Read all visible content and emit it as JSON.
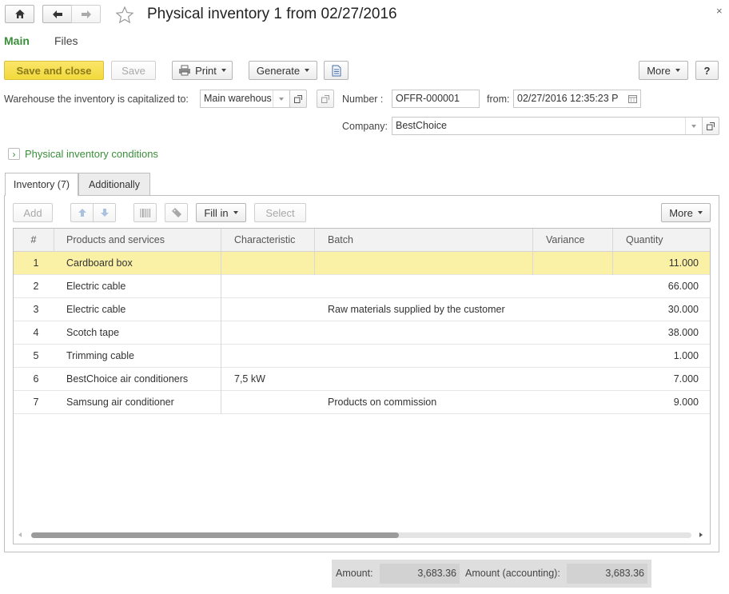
{
  "window": {
    "title": "Physical inventory 1 from 02/27/2016",
    "close_glyph": "×"
  },
  "nav": {
    "home_icon": "home-icon",
    "back_icon": "arrow-left-icon",
    "forward_icon": "arrow-right-icon",
    "favorite_icon": "star-icon"
  },
  "sections": {
    "main": "Main",
    "files": "Files"
  },
  "toolbar": {
    "save_and_close": "Save and close",
    "save": "Save",
    "print": "Print",
    "generate": "Generate",
    "more": "More",
    "help": "?"
  },
  "header": {
    "warehouse_label": "Warehouse the inventory is capitalized to:",
    "warehouse_value": "Main warehous",
    "number_label": "Number :",
    "number_value": "OFFR-000001",
    "from_label": "from:",
    "from_value": "02/27/2016 12:35:23 P",
    "company_label": "Company:",
    "company_value": "BestChoice"
  },
  "conditions": {
    "label": "Physical inventory conditions",
    "expander_glyph": "›"
  },
  "tabs": [
    {
      "label": "Inventory (7)"
    },
    {
      "label": "Additionally"
    }
  ],
  "grid_toolbar": {
    "add": "Add",
    "fill_in": "Fill in",
    "select": "Select",
    "more": "More"
  },
  "table": {
    "columns": [
      "#",
      "Products and services",
      "Characteristic",
      "Batch",
      "Variance",
      "Quantity"
    ],
    "rows": [
      {
        "num": "1",
        "product": "Cardboard box",
        "characteristic": "",
        "batch": "",
        "variance": "",
        "quantity": "11.000"
      },
      {
        "num": "2",
        "product": "Electric cable",
        "characteristic": "",
        "batch": "",
        "variance": "",
        "quantity": "66.000"
      },
      {
        "num": "3",
        "product": "Electric cable",
        "characteristic": "",
        "batch": "Raw materials supplied by the customer",
        "variance": "",
        "quantity": "30.000"
      },
      {
        "num": "4",
        "product": "Scotch tape",
        "characteristic": "",
        "batch": "",
        "variance": "",
        "quantity": "38.000"
      },
      {
        "num": "5",
        "product": "Trimming cable",
        "characteristic": "",
        "batch": "",
        "variance": "",
        "quantity": "1.000"
      },
      {
        "num": "6",
        "product": "BestChoice air conditioners",
        "characteristic": "7,5 kW",
        "batch": "",
        "variance": "",
        "quantity": "7.000"
      },
      {
        "num": "7",
        "product": "Samsung air conditioner",
        "characteristic": "",
        "batch": "Products on commission",
        "variance": "",
        "quantity": "9.000"
      }
    ]
  },
  "totals": {
    "amount_label": "Amount:",
    "amount_value": "3,683.36",
    "amount_acc_label": "Amount (accounting):",
    "amount_acc_value": "3,683.36"
  },
  "colors": {
    "accent_green": "#3a8f3a",
    "selected_row": "#fbf1a6",
    "primary_button": "#f2d93c"
  }
}
